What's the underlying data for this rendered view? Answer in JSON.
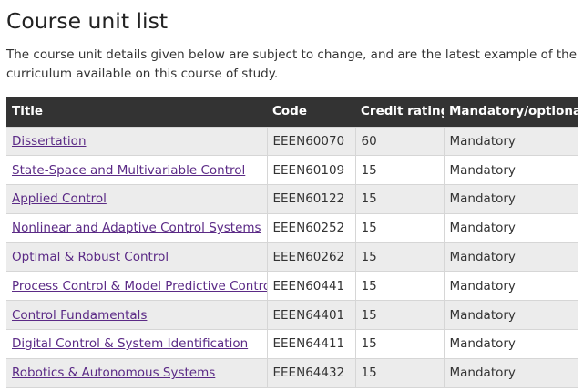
{
  "page": {
    "title": "Course unit list",
    "intro": "The course unit details given below are subject to change, and are the latest example of the curriculum available on this course of study."
  },
  "table": {
    "headers": {
      "title": "Title",
      "code": "Code",
      "credit": "Credit rating",
      "mandatory": "Mandatory/optional"
    },
    "rows": [
      {
        "title": "Dissertation",
        "code": "EEEN60070",
        "credit": "60",
        "status": "Mandatory"
      },
      {
        "title": "State-Space and Multivariable Control",
        "code": "EEEN60109",
        "credit": "15",
        "status": "Mandatory"
      },
      {
        "title": "Applied Control",
        "code": "EEEN60122",
        "credit": "15",
        "status": "Mandatory"
      },
      {
        "title": "Nonlinear and Adaptive Control Systems",
        "code": "EEEN60252",
        "credit": "15",
        "status": "Mandatory"
      },
      {
        "title": "Optimal & Robust Control",
        "code": "EEEN60262",
        "credit": "15",
        "status": "Mandatory"
      },
      {
        "title": "Process Control & Model Predictive Control",
        "code": "EEEN60441",
        "credit": "15",
        "status": "Mandatory"
      },
      {
        "title": "Control Fundamentals",
        "code": "EEEN64401",
        "credit": "15",
        "status": "Mandatory"
      },
      {
        "title": "Digital Control & System Identification",
        "code": "EEEN64411",
        "credit": "15",
        "status": "Mandatory"
      },
      {
        "title": "Robotics & Autonomous Systems",
        "code": "EEEN64432",
        "credit": "15",
        "status": "Mandatory"
      }
    ]
  },
  "colors": {
    "header_bg": "#333333",
    "link": "#5b2a86",
    "row_alt": "#ececec"
  }
}
